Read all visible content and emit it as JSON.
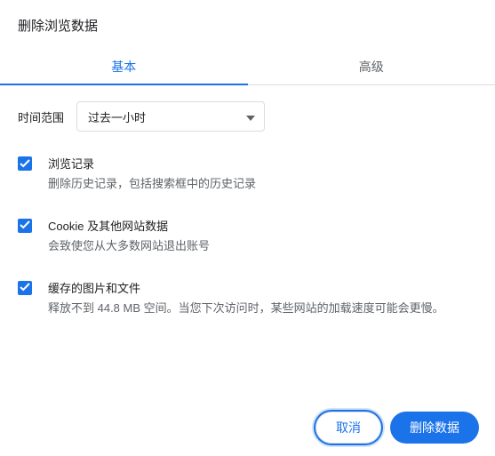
{
  "dialog": {
    "title": "删除浏览数据"
  },
  "tabs": {
    "basic": "基本",
    "advanced": "高级"
  },
  "time": {
    "label": "时间范围",
    "selected": "过去一小时"
  },
  "options": [
    {
      "title": "浏览记录",
      "desc": "删除历史记录，包括搜索框中的历史记录"
    },
    {
      "title": "Cookie 及其他网站数据",
      "desc": "会致使您从大多数网站退出账号"
    },
    {
      "title": "缓存的图片和文件",
      "desc": "释放不到 44.8 MB 空间。当您下次访问时，某些网站的加载速度可能会更慢。"
    }
  ],
  "buttons": {
    "cancel": "取消",
    "confirm": "删除数据"
  }
}
